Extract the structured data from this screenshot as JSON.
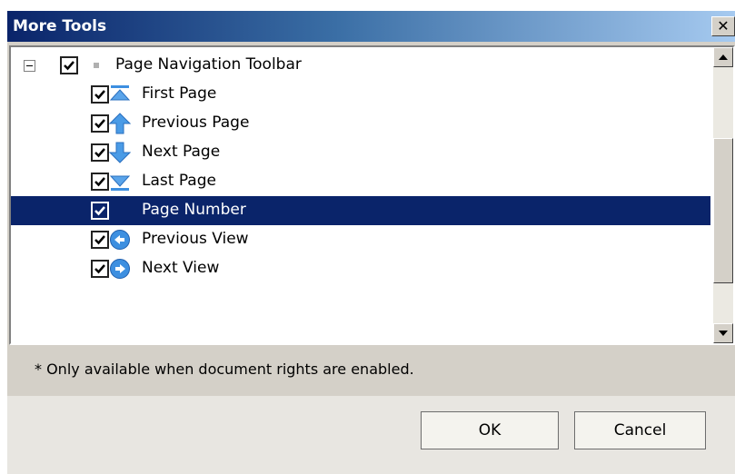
{
  "window": {
    "title": "More Tools",
    "close_glyph": "✕"
  },
  "tree": {
    "parent": {
      "label": "Page Navigation Toolbar",
      "checked": true,
      "expanded": true
    },
    "items": [
      {
        "label": "First Page",
        "icon": "first-page-icon",
        "checked": true,
        "selected": false
      },
      {
        "label": "Previous Page",
        "icon": "previous-page-icon",
        "checked": true,
        "selected": false
      },
      {
        "label": "Next Page",
        "icon": "next-page-icon",
        "checked": true,
        "selected": false
      },
      {
        "label": "Last Page",
        "icon": "last-page-icon",
        "checked": true,
        "selected": false
      },
      {
        "label": "Page Number",
        "icon": "",
        "checked": true,
        "selected": true
      },
      {
        "label": "Previous View",
        "icon": "previous-view-icon",
        "checked": true,
        "selected": false
      },
      {
        "label": "Next View",
        "icon": "next-view-icon",
        "checked": true,
        "selected": false
      }
    ]
  },
  "note": "* Only available when document rights are enabled.",
  "buttons": {
    "ok": "OK",
    "cancel": "Cancel"
  },
  "colors": {
    "selection": "#0a246a",
    "title_start": "#0a246a",
    "title_end": "#a6caf0",
    "icon_blue": "#3d8fe0"
  }
}
